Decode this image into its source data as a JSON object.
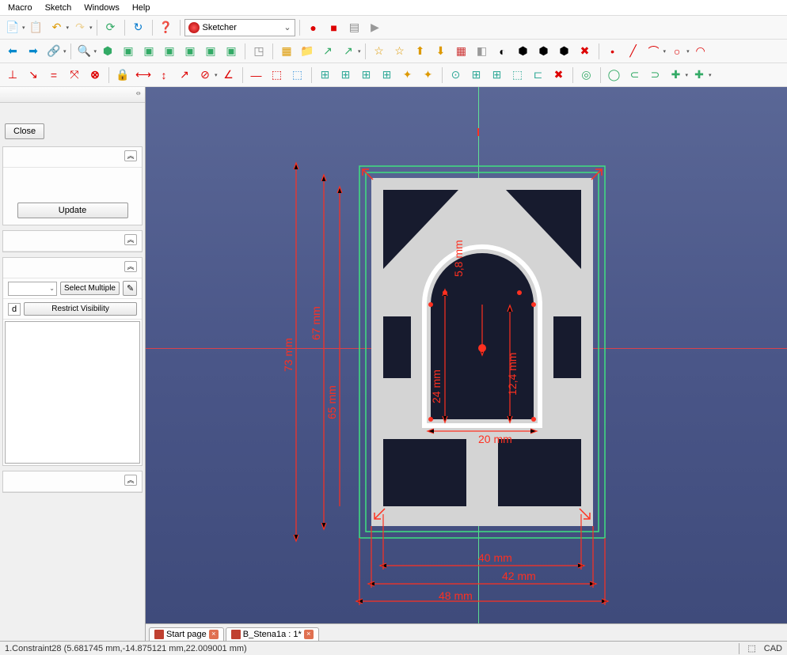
{
  "menu": {
    "items": [
      "Macro",
      "Sketch",
      "Windows",
      "Help"
    ]
  },
  "workbench": {
    "label": "Sketcher"
  },
  "panel": {
    "close": "Close",
    "update": "Update",
    "select_multiple": "Select Multiple",
    "restrict": "Restrict Visibility",
    "filter_d": "d"
  },
  "tabs": {
    "start": "Start page",
    "doc": "B_Stena1a : 1*"
  },
  "status": {
    "left": "1.Constraint28 (5.681745 mm,-14.875121 mm,22.009001 mm)",
    "right": "CAD"
  },
  "dims": {
    "d73": "73 mm",
    "d67": "67 mm",
    "d65": "65 mm",
    "d58": "5,8 mm",
    "d24": "24 mm",
    "d124": "12,4 mm",
    "d20": "20 mm",
    "d40": "40 mm",
    "d42": "42 mm",
    "d48": "48 mm"
  }
}
